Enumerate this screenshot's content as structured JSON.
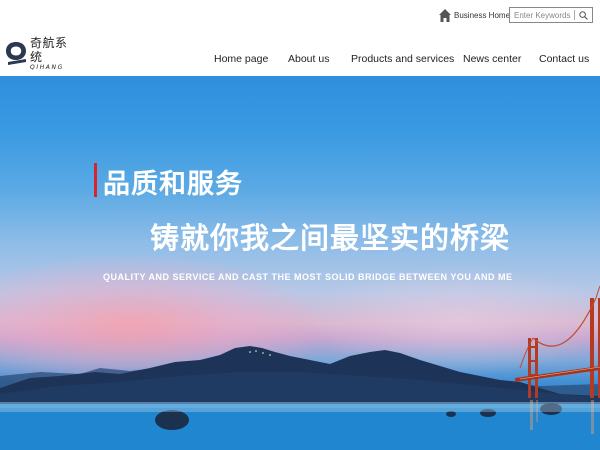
{
  "topbar": {
    "home_label": "Business Home",
    "home_icon": "house-icon",
    "search": {
      "placeholder": "Enter Keywords",
      "value": "",
      "button_icon": "magnifier-icon"
    }
  },
  "logo": {
    "cn": "奇航系统",
    "en": "QIHANG"
  },
  "nav": {
    "items": [
      {
        "label": "Home page"
      },
      {
        "label": "About us"
      },
      {
        "label": "Products and services"
      },
      {
        "label": "News center"
      },
      {
        "label": "Contact us"
      }
    ]
  },
  "hero": {
    "headline_1": "品质和服务",
    "headline_2": "铸就你我之间最坚实的桥梁",
    "tagline": "QUALITY AND SERVICE AND CAST THE MOST SOLID BRIDGE BETWEEN YOU AND ME",
    "accent_color": "#d8242b"
  }
}
